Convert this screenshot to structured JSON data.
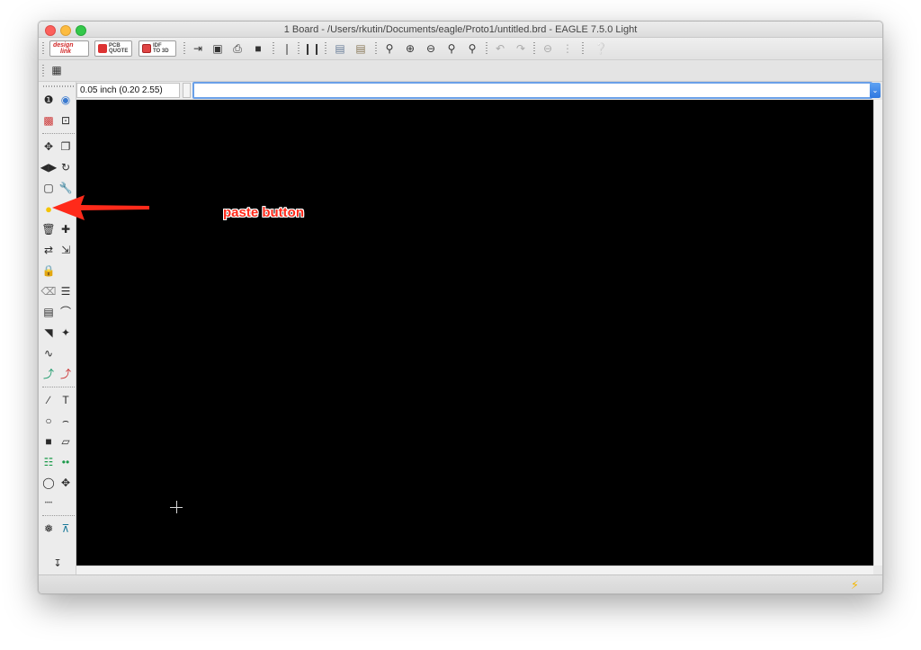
{
  "window": {
    "title": "1 Board - /Users/rkutin/Documents/eagle/Proto1/untitled.brd - EAGLE 7.5.0 Light"
  },
  "toolbar": {
    "design_link": {
      "label_top": "design",
      "label_bottom": "link"
    },
    "pcb_quote": {
      "label_top": "PCB",
      "label_bottom": "QUOTE"
    },
    "idf_3d": {
      "label_top": "IDF",
      "label_bottom": "TO 3D"
    }
  },
  "command": {
    "coordinate": "0.05 inch (0.20 2.55)",
    "input_value": "",
    "input_placeholder": ""
  },
  "annotation": {
    "text": "paste button",
    "color": "#ff2a1a"
  },
  "colors": {
    "canvas": "#000000",
    "accent": "#2f78e0",
    "paste_icon": "#f5c400"
  }
}
